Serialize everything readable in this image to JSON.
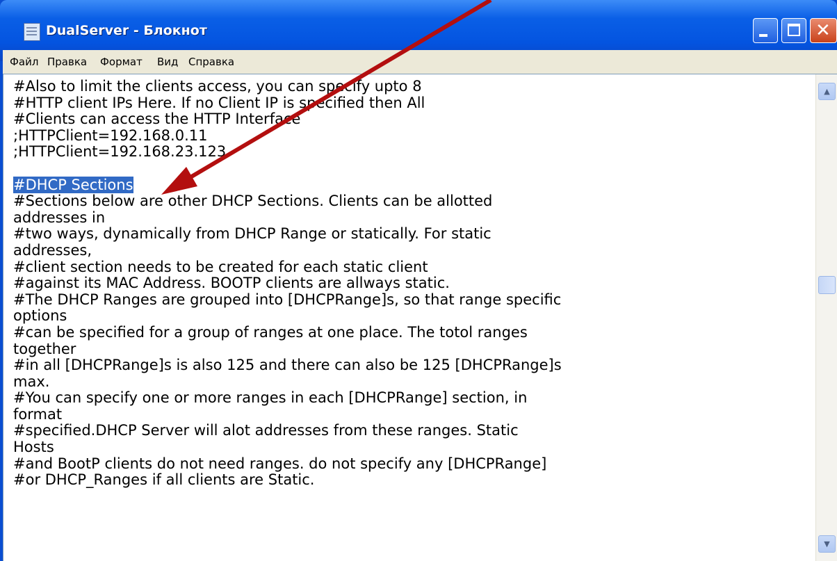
{
  "window": {
    "title": "DualServer - Блокнот"
  },
  "menu": [
    {
      "label": "Файл"
    },
    {
      "label": "Правка"
    },
    {
      "label": "Формат"
    },
    {
      "label": "Вид"
    },
    {
      "label": "Справка"
    }
  ],
  "editor": {
    "lines": [
      "#Also to limit the clients access, you can specify upto 8",
      "#HTTP client IPs Here. If no Client IP is specified then All",
      "#Clients can access the HTTP Interface",
      ";HTTPClient=192.168.0.11",
      ";HTTPClient=192.168.23.123",
      "",
      "#DHCP Sections",
      "#Sections below are other DHCP Sections. Clients can be allotted",
      "addresses in",
      "#two ways, dynamically from DHCP Range or statically. For static",
      "addresses,",
      "#client section needs to be created for each static client",
      "#against its MAC Address. BOOTP clients are allways static.",
      "#The DHCP Ranges are grouped into [DHCPRange]s, so that range specific",
      "options",
      "#can be specified for a group of ranges at one place. The totol ranges",
      "together",
      "#in all [DHCPRange]s is also 125 and there can also be 125 [DHCPRange]s",
      "max.",
      "#You can specify one or more ranges in each [DHCPRange] section, in",
      "format",
      "#specified.DHCP Server will alot addresses from these ranges. Static",
      "Hosts",
      "#and BootP clients do not need ranges. do not specify any [DHCPRange]",
      "#or DHCP_Ranges if all clients are Static."
    ],
    "selected_line": "#DHCP Sections"
  },
  "icons": {
    "app": "notepad-icon",
    "minimize": "minimize-icon",
    "maximize": "maximize-icon",
    "close": "close-icon",
    "scroll_up": "chevron-up-icon",
    "scroll_down": "chevron-down-icon"
  },
  "colors": {
    "title_bar": "#0454e0",
    "selection": "#316ac5",
    "annotation_arrow": "#b30f0f"
  }
}
